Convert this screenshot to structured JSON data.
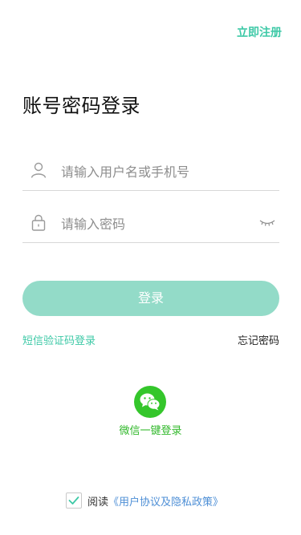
{
  "header": {
    "register_label": "立即注册"
  },
  "title": "账号密码登录",
  "form": {
    "username_placeholder": "请输入用户名或手机号",
    "password_placeholder": "请输入密码"
  },
  "login_button": "登录",
  "links": {
    "sms_login": "短信验证码登录",
    "forgot_password": "忘记密码"
  },
  "wechat": {
    "label": "微信一键登录"
  },
  "agreement": {
    "checked": true,
    "prefix": "阅读",
    "link": "《用户协议及隐私政策》"
  },
  "colors": {
    "accent": "#3ec9a7",
    "button_bg": "#93dbc8",
    "wechat_green": "#34c62b",
    "link_blue": "#4e8fd6"
  },
  "icons": {
    "user": "user-icon",
    "lock": "lock-icon",
    "eye": "eye-closed-icon",
    "wechat": "wechat-icon",
    "check": "check-icon"
  }
}
